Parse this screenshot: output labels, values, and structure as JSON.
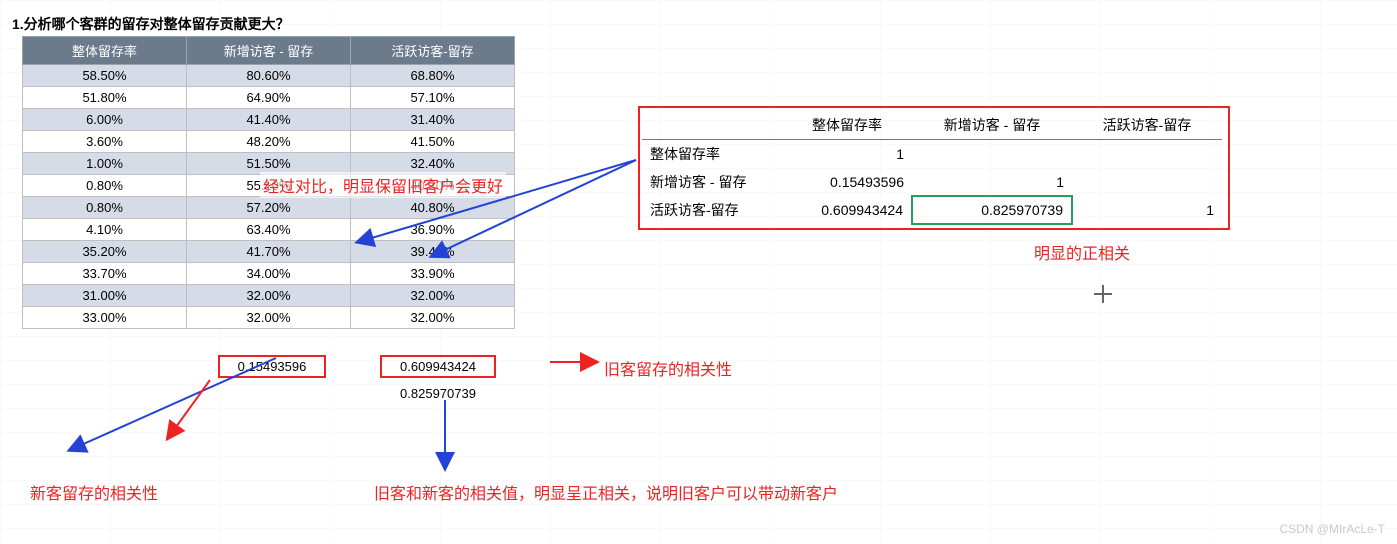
{
  "title": "1.分析哪个客群的留存对整体留存贡献更大？",
  "table": {
    "headers": [
      "整体留存率",
      "新增访客 - 留存",
      "活跃访客-留存"
    ],
    "rows": [
      [
        "58.50%",
        "80.60%",
        "68.80%"
      ],
      [
        "51.80%",
        "64.90%",
        "57.10%"
      ],
      [
        "6.00%",
        "41.40%",
        "31.40%"
      ],
      [
        "3.60%",
        "48.20%",
        "41.50%"
      ],
      [
        "1.00%",
        "51.50%",
        "32.40%"
      ],
      [
        "0.80%",
        "55.10%",
        "40.20%"
      ],
      [
        "0.80%",
        "57.20%",
        "40.80%"
      ],
      [
        "4.10%",
        "63.40%",
        "36.90%"
      ],
      [
        "35.20%",
        "41.70%",
        "39.40%"
      ],
      [
        "33.70%",
        "34.00%",
        "33.90%"
      ],
      [
        "31.00%",
        "32.00%",
        "32.00%"
      ],
      [
        "33.00%",
        "32.00%",
        "32.00%"
      ]
    ]
  },
  "bottom": {
    "val1": "0.15493596",
    "val2": "0.609943424",
    "val3": "0.825970739"
  },
  "corr": {
    "headers": [
      "",
      "整体留存率",
      "新增访客 - 留存",
      "活跃访客-留存"
    ],
    "rows": [
      {
        "label": "整体留存率",
        "c1": "1",
        "c2": "",
        "c3": ""
      },
      {
        "label": "新增访客 - 留存",
        "c1": "0.15493596",
        "c2": "1",
        "c3": ""
      },
      {
        "label": "活跃访客-留存",
        "c1": "0.609943424",
        "c2": "0.825970739",
        "c3": "1"
      }
    ]
  },
  "notes": {
    "compare": "经过对比，明显保留旧客户会更好",
    "poscorr": "明显的正相关",
    "oldcorr": "旧客留存的相关性",
    "newcorr": "新客留存的相关性",
    "combo": "旧客和新客的相关值，明显呈正相关，说明旧客户可以带动新客户"
  },
  "watermark": "CSDN @MIrAcLe-T"
}
